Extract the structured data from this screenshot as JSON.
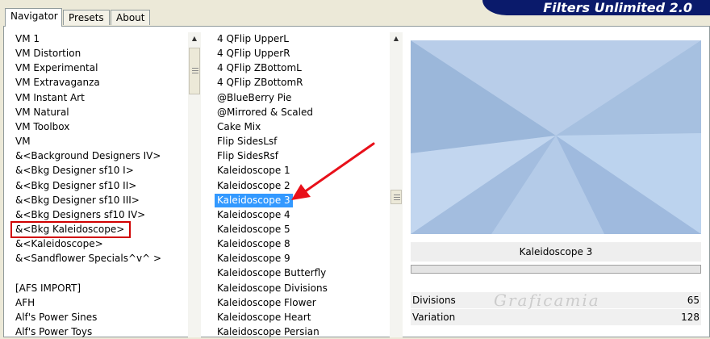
{
  "tabs": [
    {
      "label": "Navigator"
    },
    {
      "label": "Presets"
    },
    {
      "label": "About"
    }
  ],
  "brand": "Filters Unlimited 2.0",
  "categories": [
    "VM 1",
    "VM Distortion",
    "VM Experimental",
    "VM Extravaganza",
    "VM Instant Art",
    "VM Natural",
    "VM Toolbox",
    "VM",
    "&<Background Designers IV>",
    "&<Bkg Designer sf10 I>",
    "&<Bkg Designer sf10 II>",
    "&<Bkg Designer sf10 III>",
    "&<Bkg Designers sf10 IV>",
    "&<Bkg Kaleidoscope>",
    "&<Kaleidoscope>",
    "&<Sandflower Specials^v^ >",
    "",
    "[AFS IMPORT]",
    "AFH",
    "Alf's Power Sines",
    "Alf's Power Toys"
  ],
  "selected_category": "&<Bkg Kaleidoscope>",
  "filters": [
    "4 QFlip UpperL",
    "4 QFlip UpperR",
    "4 QFlip ZBottomL",
    "4 QFlip ZBottomR",
    "@BlueBerry Pie",
    "@Mirrored & Scaled",
    "Cake Mix",
    "Flip SidesLsf",
    "Flip SidesRsf",
    "Kaleidoscope 1",
    "Kaleidoscope 2",
    "Kaleidoscope 3",
    "Kaleidoscope 4",
    "Kaleidoscope 5",
    "Kaleidoscope 8",
    "Kaleidoscope 9",
    "Kaleidoscope Butterfly",
    "Kaleidoscope Divisions",
    "Kaleidoscope Flower",
    "Kaleidoscope Heart",
    "Kaleidoscope Persian"
  ],
  "selected_filter": "Kaleidoscope 3",
  "filter_title": "Kaleidoscope 3",
  "params": [
    {
      "label": "Divisions",
      "value": "65"
    },
    {
      "label": "Variation",
      "value": "128"
    }
  ],
  "watermark": "Graficamia",
  "colors": {
    "selection": "#3399ff",
    "highlight_box": "#d00000",
    "arrow": "#e8101a",
    "banner": "#0a1a6b"
  }
}
